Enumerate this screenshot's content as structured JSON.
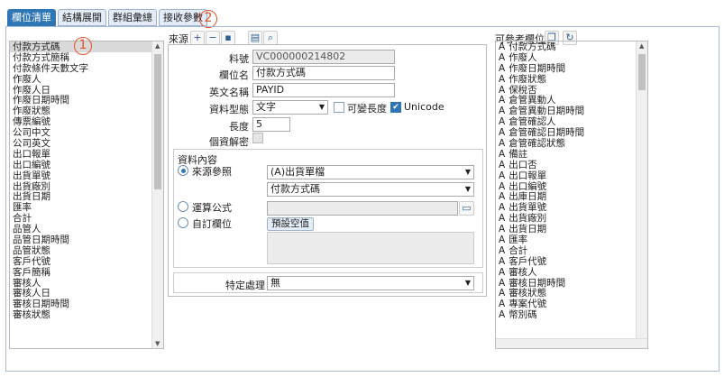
{
  "tabs": [
    {
      "label": "欄位清單"
    },
    {
      "label": "結構展開"
    },
    {
      "label": "群組彙總"
    },
    {
      "label": "接收參數"
    }
  ],
  "callouts": {
    "one": "1",
    "two": "2"
  },
  "left_list": {
    "selected": "付款方式碼",
    "items": [
      "付款方式碼",
      "付款方式簡稱",
      "付款條件天數文字",
      "作廢人",
      "作廢人日",
      "作廢日期時間",
      "作廢狀態",
      "傳票編號",
      "公司中文",
      "公司英文",
      "出口報單",
      "出口編號",
      "出貨單號",
      "出貨廠別",
      "出貨日期",
      "匯率",
      "合計",
      "品管人",
      "品管日期時間",
      "品管狀態",
      "客戶代號",
      "客戶簡稱",
      "審核人",
      "審核人日",
      "審核日期時間",
      "審核狀態"
    ]
  },
  "source": {
    "label": "來源"
  },
  "form": {
    "code_label": "料號",
    "code_value": "VC000000214802",
    "name_label": "欄位名",
    "name_value": "付款方式碼",
    "en_label": "英文名稱",
    "en_value": "PAYID",
    "type_label": "資料型態",
    "type_value": "文字",
    "var_len_label": "可變長度",
    "unicode_label": "Unicode",
    "len_label": "長度",
    "len_value": "5",
    "encrypt_label": "個資解密"
  },
  "content": {
    "title": "資料內容",
    "src_ref": "來源參照",
    "src_sel1": "(A)出貨單檔",
    "src_sel2": "付款方式碼",
    "formula": "運算公式",
    "custom": "自訂欄位",
    "default_btn": "預設空值"
  },
  "special": {
    "label": "特定處理",
    "value": "無"
  },
  "right_list": {
    "title": "可參考欄位",
    "prefix": "A",
    "items": [
      "付款方式碼",
      "作廢人",
      "作廢日期時間",
      "作廢狀態",
      "保稅否",
      "倉管異動人",
      "倉管異動日期時間",
      "倉管確認人",
      "倉管確認日期時間",
      "倉管確認狀態",
      "備註",
      "出口否",
      "出口報單",
      "出口編號",
      "出庫日期",
      "出貨單號",
      "出貨廠別",
      "出貨日期",
      "匯率",
      "合計",
      "客戶代號",
      "審核人",
      "審核日期時間",
      "審核狀態",
      "專案代號",
      "幣別碼"
    ]
  }
}
